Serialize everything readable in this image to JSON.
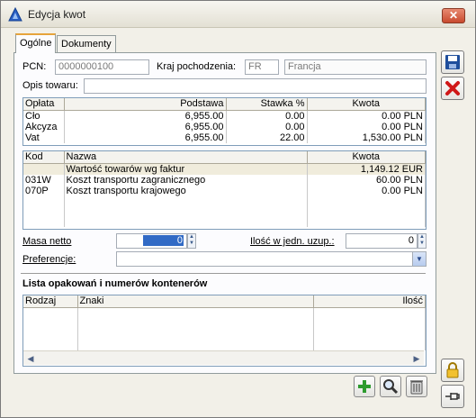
{
  "window": {
    "title": "Edycja kwot"
  },
  "tabs": [
    {
      "label": "Ogólne",
      "active": true
    },
    {
      "label": "Dokumenty",
      "active": false
    }
  ],
  "form": {
    "pcn_label": "PCN:",
    "pcn_value": "0000000100",
    "kraj_label": "Kraj pochodzenia:",
    "kraj_code": "FR",
    "kraj_name": "Francja",
    "opis_label": "Opis towaru:",
    "opis_value": ""
  },
  "fees_table": {
    "headers": [
      "Opłata",
      "Podstawa",
      "Stawka %",
      "Kwota"
    ],
    "rows": [
      [
        "Cło",
        "6,955.00",
        "0.00",
        "0.00 PLN"
      ],
      [
        "Akcyza",
        "6,955.00",
        "0.00",
        "0.00 PLN"
      ],
      [
        "Vat",
        "6,955.00",
        "22.00",
        "1,530.00 PLN"
      ]
    ]
  },
  "costs_table": {
    "headers": [
      "Kod",
      "Nazwa",
      "Kwota"
    ],
    "rows": [
      [
        "",
        "Wartość towarów wg faktur",
        "1,149.12 EUR"
      ],
      [
        "031W",
        "Koszt transportu zagranicznego",
        "60.00 PLN"
      ],
      [
        "070P",
        "Koszt transportu krajowego",
        "0.00 PLN"
      ]
    ]
  },
  "masa": {
    "label": "Masa netto",
    "value": "0"
  },
  "ilosc": {
    "label": "Ilość w jedn. uzup.:",
    "value": "0"
  },
  "preferencje": {
    "label": "Preferencje:",
    "value": ""
  },
  "containers": {
    "title": "Lista opakowań i numerów kontenerów",
    "headers": [
      "Rodzaj",
      "Znaki",
      "Ilość"
    ]
  },
  "colors": {
    "accent_tab": "#e6a43b",
    "grid_border": "#7f9db9",
    "save_icon": "#1f4e9c",
    "delete_icon": "#d01818",
    "add_icon": "#2e9b2e"
  },
  "icons": [
    "app-icon",
    "save-icon",
    "delete-icon",
    "lock-icon",
    "pin-icon",
    "add-icon",
    "search-icon",
    "trash-icon"
  ]
}
